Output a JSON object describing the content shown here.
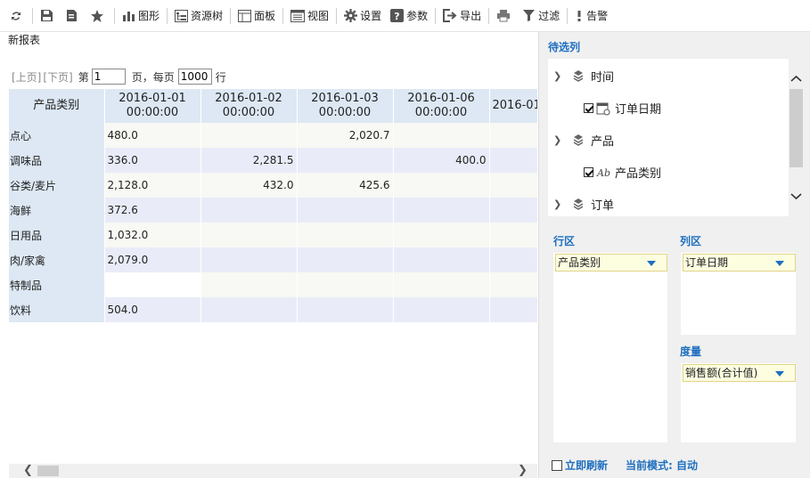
{
  "toolbar": {
    "items": [
      {
        "icon": "refresh-icon",
        "label": ""
      },
      {
        "icon": "save-icon",
        "label": ""
      },
      {
        "icon": "save-as-icon",
        "label": ""
      },
      {
        "icon": "star-icon",
        "label": ""
      },
      {
        "icon": "chart-icon",
        "label": "图形"
      },
      {
        "icon": "tree-icon",
        "label": "资源树"
      },
      {
        "icon": "panel-icon",
        "label": "面板"
      },
      {
        "icon": "view-icon",
        "label": "视图"
      },
      {
        "icon": "gear-icon",
        "label": "设置"
      },
      {
        "icon": "question-icon",
        "label": "参数"
      },
      {
        "icon": "export-icon",
        "label": "导出"
      },
      {
        "icon": "print-icon",
        "label": ""
      },
      {
        "icon": "filter-icon",
        "label": "过滤"
      },
      {
        "icon": "alert-icon",
        "label": "告警"
      }
    ]
  },
  "report": {
    "title": "新报表"
  },
  "pager": {
    "prev": "[上页]",
    "next": "[下页]",
    "page_prefix": "第",
    "page_value": "1",
    "page_suffix": "页，",
    "size_prefix": "每页",
    "size_value": "1000",
    "size_suffix": "行"
  },
  "grid": {
    "corner": "产品类别",
    "columns": [
      "2016-01-01 00:00:00",
      "2016-01-02 00:00:00",
      "2016-01-03 00:00:00",
      "2016-01-06 00:00:00",
      "2016-01"
    ],
    "rows": [
      {
        "label": "点心",
        "cells": [
          "480.0",
          "",
          "2,020.7",
          "",
          ""
        ]
      },
      {
        "label": "调味品",
        "cells": [
          "336.0",
          "2,281.5",
          "",
          "400.0",
          ""
        ]
      },
      {
        "label": "谷类/麦片",
        "cells": [
          "2,128.0",
          "432.0",
          "425.6",
          "",
          ""
        ]
      },
      {
        "label": "海鲜",
        "cells": [
          "372.6",
          "",
          "",
          "",
          ""
        ]
      },
      {
        "label": "日用品",
        "cells": [
          "1,032.0",
          "",
          "",
          "",
          ""
        ]
      },
      {
        "label": "肉/家禽",
        "cells": [
          "2,079.0",
          "",
          "",
          "",
          ""
        ]
      },
      {
        "label": "特制品",
        "cells": [
          "",
          "",
          "",
          "",
          ""
        ]
      },
      {
        "label": "饮料",
        "cells": [
          "504.0",
          "",
          "",
          "",
          ""
        ]
      }
    ]
  },
  "panel": {
    "candidates_title": "待选列",
    "tree": [
      {
        "label": "时间",
        "icon": "dimension-icon",
        "level": 0
      },
      {
        "label": "订单日期",
        "icon": "date-field-icon",
        "level": 1,
        "checked": true
      },
      {
        "label": "产品",
        "icon": "dimension-icon",
        "level": 0
      },
      {
        "label": "产品类别",
        "icon": "text-field-icon",
        "level": 1,
        "checked": true
      },
      {
        "label": "订单",
        "icon": "dimension-icon",
        "level": 0
      }
    ],
    "row_zone_title": "行区",
    "row_zone_field": "产品类别",
    "col_zone_title": "列区",
    "col_zone_field": "订单日期",
    "measure_title": "度量",
    "measure_field": "销售额(合计值)",
    "refresh_label": "立即刷新",
    "mode_label": "当前模式: 自动"
  },
  "colors": {
    "accent": "#1e6fbf",
    "header_bg": "#dde8f4",
    "row_alt": "#e9ecf8",
    "row_base": "#f8f8f4",
    "pill_bg": "#fdfde0"
  }
}
